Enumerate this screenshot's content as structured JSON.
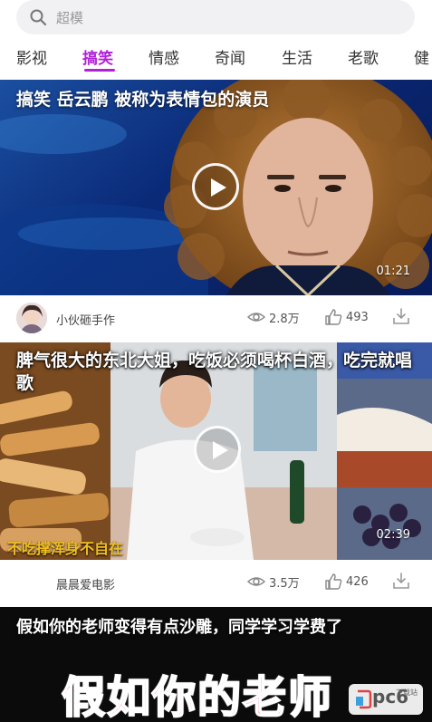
{
  "search": {
    "placeholder": "超模"
  },
  "tabs": [
    {
      "label": "影视"
    },
    {
      "label": "搞笑",
      "active": true
    },
    {
      "label": "情感"
    },
    {
      "label": "奇闻"
    },
    {
      "label": "生活"
    },
    {
      "label": "老歌"
    },
    {
      "label": "健"
    }
  ],
  "videos": [
    {
      "title": "搞笑 岳云鹏 被称为表情包的演员",
      "duration": "01:21",
      "author": "小伙砸手作",
      "views": "2.8万",
      "likes": "493"
    },
    {
      "title": "脾气很大的东北大姐，吃饭必须喝杯白酒，吃完就唱歌",
      "caption": "不吃撑浑身不自在",
      "duration": "02:39",
      "author": "晨晨爱电影",
      "views": "3.5万",
      "likes": "426"
    },
    {
      "title": "假如你的老师变得有点沙雕，同学学习学费了",
      "big_caption": "假如你的老师"
    }
  ],
  "watermark": {
    "text": "pc6",
    "sub": "下载站"
  },
  "colors": {
    "accent": "#b021d8"
  },
  "icons": [
    "search-icon",
    "play-icon",
    "eye-icon",
    "thumbs-up-icon",
    "download-icon"
  ]
}
